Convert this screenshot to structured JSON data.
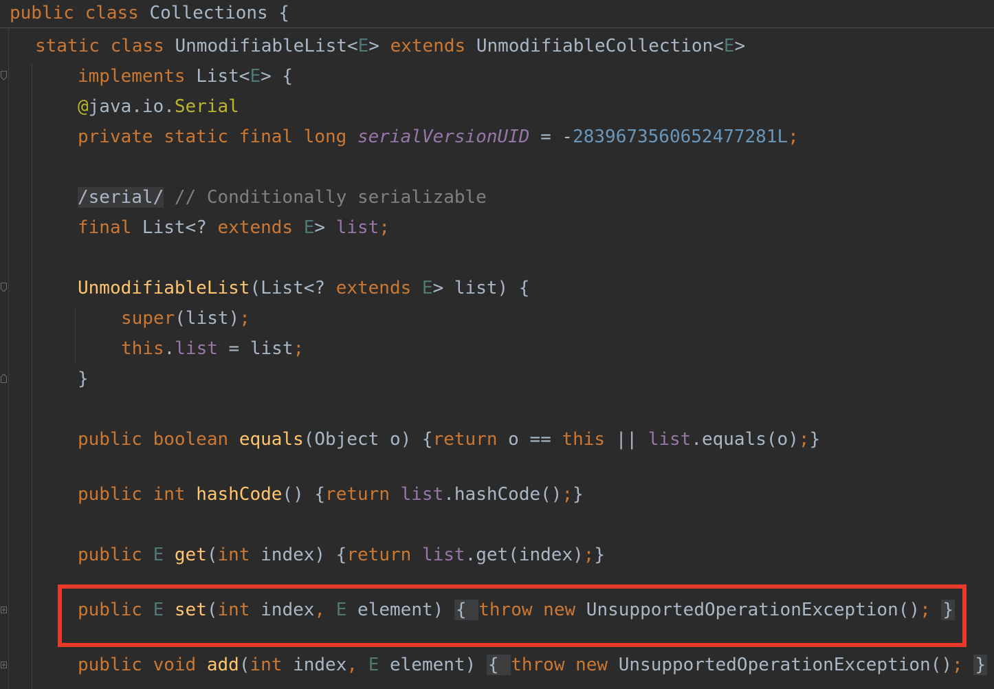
{
  "editor": {
    "lines": [
      {
        "id": "l1",
        "tokens": [
          [
            "kw",
            "public class "
          ],
          [
            "",
            "Collections {"
          ]
        ]
      },
      {
        "id": "l2",
        "tokens": [
          [
            "kw",
            "static class "
          ],
          [
            "",
            "UnmodifiableList<"
          ],
          [
            "tp",
            "E"
          ],
          [
            "",
            "> "
          ],
          [
            "kw",
            "extends "
          ],
          [
            "",
            "UnmodifiableCollection<"
          ],
          [
            "tp",
            "E"
          ],
          [
            "",
            ">"
          ]
        ]
      },
      {
        "id": "l3",
        "tokens": [
          [
            "kw",
            "implements "
          ],
          [
            "",
            "List<"
          ],
          [
            "tp",
            "E"
          ],
          [
            "",
            "> {"
          ]
        ]
      },
      {
        "id": "l4",
        "tokens": [
          [
            "ann",
            "@"
          ],
          [
            "",
            "java.io."
          ],
          [
            "ann",
            "Serial"
          ]
        ]
      },
      {
        "id": "l5",
        "tokens": [
          [
            "kw",
            "private static final long "
          ],
          [
            "sfld",
            "serialVersionUID"
          ],
          [
            "",
            " = -"
          ],
          [
            "num",
            "2839673560652477281L"
          ],
          [
            "semi",
            ";"
          ]
        ]
      },
      {
        "id": "l6",
        "tokens": [
          [
            "serialbox",
            "/serial/"
          ],
          [
            "cmt",
            " // Conditionally serializable"
          ]
        ]
      },
      {
        "id": "l7",
        "tokens": [
          [
            "kw",
            "final "
          ],
          [
            "",
            "List<? "
          ],
          [
            "kw",
            "extends "
          ],
          [
            "tp",
            "E"
          ],
          [
            "",
            "> "
          ],
          [
            "fld",
            "list"
          ],
          [
            "semi",
            ";"
          ]
        ]
      },
      {
        "id": "l8",
        "tokens": [
          [
            "fn",
            "UnmodifiableList"
          ],
          [
            "",
            "(List<? "
          ],
          [
            "kw",
            "extends "
          ],
          [
            "tp",
            "E"
          ],
          [
            "",
            "> list) {"
          ]
        ]
      },
      {
        "id": "l9",
        "tokens": [
          [
            "kw",
            "super"
          ],
          [
            "",
            "(list)"
          ],
          [
            "semi",
            ";"
          ]
        ]
      },
      {
        "id": "l10",
        "tokens": [
          [
            "kw",
            "this"
          ],
          [
            "",
            "."
          ],
          [
            "fld",
            "list"
          ],
          [
            "",
            " = list"
          ],
          [
            "semi",
            ";"
          ]
        ]
      },
      {
        "id": "l11",
        "tokens": [
          [
            "",
            "}"
          ]
        ]
      },
      {
        "id": "l12",
        "tokens": [
          [
            "kw",
            "public boolean "
          ],
          [
            "fn",
            "equals"
          ],
          [
            "",
            "(Object o) {"
          ],
          [
            "kw",
            "return "
          ],
          [
            "",
            "o == "
          ],
          [
            "kw",
            "this"
          ],
          [
            "",
            " || "
          ],
          [
            "fld",
            "list"
          ],
          [
            "",
            ".equals(o)"
          ],
          [
            "semi",
            ";"
          ],
          [
            "",
            "}"
          ]
        ]
      },
      {
        "id": "l13",
        "tokens": [
          [
            "kw",
            "public int "
          ],
          [
            "fn",
            "hashCode"
          ],
          [
            "",
            "() {"
          ],
          [
            "kw",
            "return "
          ],
          [
            "fld",
            "list"
          ],
          [
            "",
            ".hashCode()"
          ],
          [
            "semi",
            ";"
          ],
          [
            "",
            "}"
          ]
        ]
      },
      {
        "id": "l14",
        "tokens": [
          [
            "kw",
            "public "
          ],
          [
            "tp",
            "E "
          ],
          [
            "fn",
            "get"
          ],
          [
            "",
            "("
          ],
          [
            "kw",
            "int "
          ],
          [
            "",
            "index) {"
          ],
          [
            "kw",
            "return "
          ],
          [
            "fld",
            "list"
          ],
          [
            "",
            ".get(index)"
          ],
          [
            "semi",
            ";"
          ],
          [
            "",
            "}"
          ]
        ]
      },
      {
        "id": "l15",
        "tokens": [
          [
            "kw",
            "public "
          ],
          [
            "tp",
            "E "
          ],
          [
            "fn",
            "set"
          ],
          [
            "",
            "("
          ],
          [
            "kw",
            "int "
          ],
          [
            "",
            "index"
          ],
          [
            "semi",
            ", "
          ],
          [
            "tp",
            "E "
          ],
          [
            "",
            "element) "
          ],
          [
            "foldbox",
            "{ "
          ],
          [
            "kw",
            "throw new "
          ],
          [
            "",
            "UnsupportedOperationException()"
          ],
          [
            "semi",
            "; "
          ],
          [
            "foldbox",
            "}"
          ]
        ]
      },
      {
        "id": "l16",
        "tokens": [
          [
            "kw",
            "public void "
          ],
          [
            "fn",
            "add"
          ],
          [
            "",
            "("
          ],
          [
            "kw",
            "int "
          ],
          [
            "",
            "index"
          ],
          [
            "semi",
            ", "
          ],
          [
            "tp",
            "E "
          ],
          [
            "",
            "element) "
          ],
          [
            "foldbox",
            "{ "
          ],
          [
            "kw",
            "throw new "
          ],
          [
            "",
            "UnsupportedOperationException()"
          ],
          [
            "semi",
            "; "
          ],
          [
            "foldbox",
            "}"
          ]
        ]
      }
    ]
  }
}
